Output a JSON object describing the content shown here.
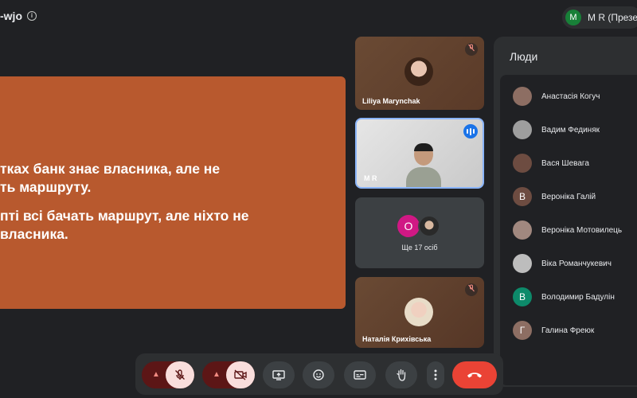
{
  "meeting": {
    "code": "-wjo"
  },
  "account": {
    "initial": "M",
    "label": "M R (Презентація)"
  },
  "slide": {
    "line1": "тках банк знає власника, але не",
    "line2": "ть маршруту.",
    "line3": "пті всі бачать маршрут, але ніхто не",
    "line4": "власника."
  },
  "tiles": {
    "tile1_name": "Liliya Marynchak",
    "tile2_name": "M R",
    "more_avatar_initial": "O",
    "more_label": "Ще 17 осіб",
    "tile4_name": "Наталія Крихівська"
  },
  "people": {
    "title": "Люди",
    "list": [
      {
        "name": "Анастасія Когуч",
        "initial": "",
        "color": "#8d6e63"
      },
      {
        "name": "Вадим Фединяк",
        "initial": "",
        "color": "#9e9e9e"
      },
      {
        "name": "Вася Шевага",
        "initial": "",
        "color": "#6d4c41"
      },
      {
        "name": "Вероніка Галій",
        "initial": "В",
        "color": "#6d4c41"
      },
      {
        "name": "Вероніка Мотовилець",
        "initial": "",
        "color": "#a1887f"
      },
      {
        "name": "Віка Романчукевич",
        "initial": "",
        "color": "#bdbdbd"
      },
      {
        "name": "Володимир Бадулін",
        "initial": "В",
        "color": "#0d8a6a"
      },
      {
        "name": "Галина Фреюк",
        "initial": "Г",
        "color": "#8d6e63"
      }
    ]
  },
  "colors": {
    "slide": "#b8592e",
    "end_call": "#ea4335",
    "muted": "#5c1616",
    "speaking": "#1a73e8"
  }
}
